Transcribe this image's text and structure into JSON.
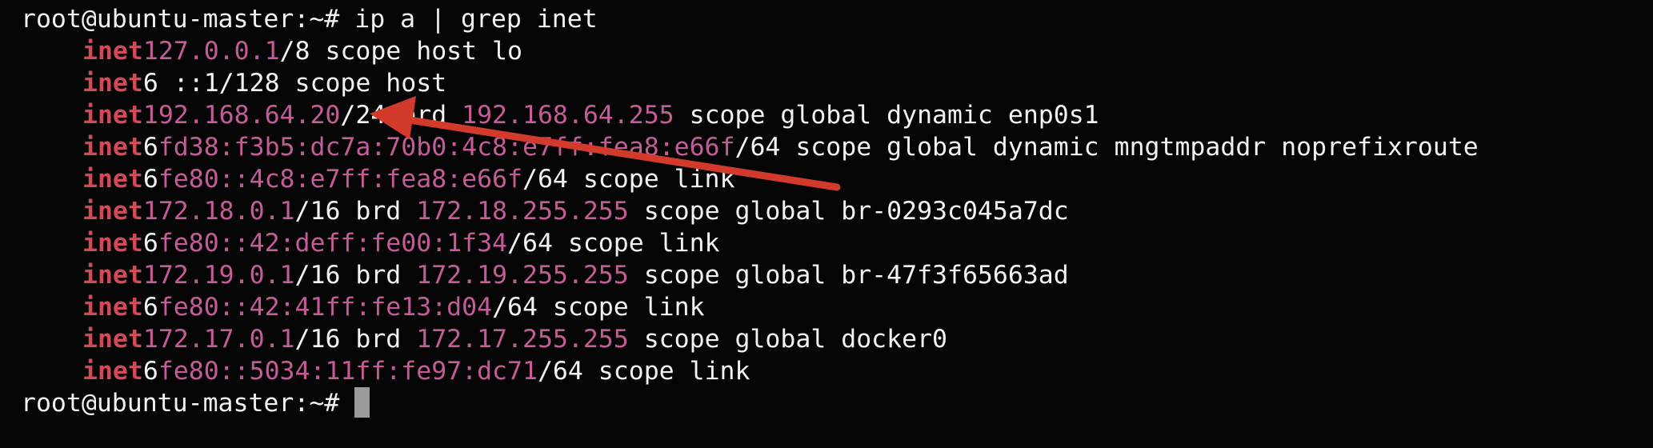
{
  "terminal": {
    "prompt": "root@ubuntu-master:~#",
    "command": " ip a | grep inet",
    "colors": {
      "background": "#050505",
      "text": "#f2f2f2",
      "keyword": "#d24a56",
      "address": "#c55c98",
      "cursor": "#9a9a9a",
      "annotation_arrow": "#d23a2c"
    },
    "lines": [
      {
        "kw": "inet",
        "v6": "",
        "addr": "127.0.0.1",
        "rest": "/8 scope host lo",
        "addr2": "",
        "rest2": ""
      },
      {
        "kw": "inet",
        "v6": "6",
        "addr": "",
        "rest": " ::1/128 scope host",
        "addr2": "",
        "rest2": ""
      },
      {
        "kw": "inet",
        "v6": "",
        "addr": "192.168.64.20",
        "rest": "/24 brd ",
        "addr2": "192.168.64.255",
        "rest2": " scope global dynamic enp0s1"
      },
      {
        "kw": "inet",
        "v6": "6",
        "addr": "fd38:f3b5:dc7a:70b0:4c8:e7ff:fea8:e66f",
        "rest": "/64 scope global dynamic mngtmpaddr noprefixroute",
        "addr2": "",
        "rest2": ""
      },
      {
        "kw": "inet",
        "v6": "6",
        "addr": "fe80::4c8:e7ff:fea8:e66f",
        "rest": "/64 scope link",
        "addr2": "",
        "rest2": ""
      },
      {
        "kw": "inet",
        "v6": "",
        "addr": "172.18.0.1",
        "rest": "/16 brd ",
        "addr2": "172.18.255.255",
        "rest2": " scope global br-0293c045a7dc"
      },
      {
        "kw": "inet",
        "v6": "6",
        "addr": "fe80::42:deff:fe00:1f34",
        "rest": "/64 scope link",
        "addr2": "",
        "rest2": ""
      },
      {
        "kw": "inet",
        "v6": "",
        "addr": "172.19.0.1",
        "rest": "/16 brd ",
        "addr2": "172.19.255.255",
        "rest2": " scope global br-47f3f65663ad"
      },
      {
        "kw": "inet",
        "v6": "6",
        "addr": "fe80::42:41ff:fe13:d04",
        "rest": "/64 scope link",
        "addr2": "",
        "rest2": ""
      },
      {
        "kw": "inet",
        "v6": "",
        "addr": "172.17.0.1",
        "rest": "/16 brd ",
        "addr2": "172.17.255.255",
        "rest2": " scope global docker0"
      },
      {
        "kw": "inet",
        "v6": "6",
        "addr": "fe80::5034:11ff:fe97:dc71",
        "rest": "/64 scope link",
        "addr2": "",
        "rest2": ""
      }
    ],
    "final_prompt": "root@ubuntu-master:~#"
  }
}
